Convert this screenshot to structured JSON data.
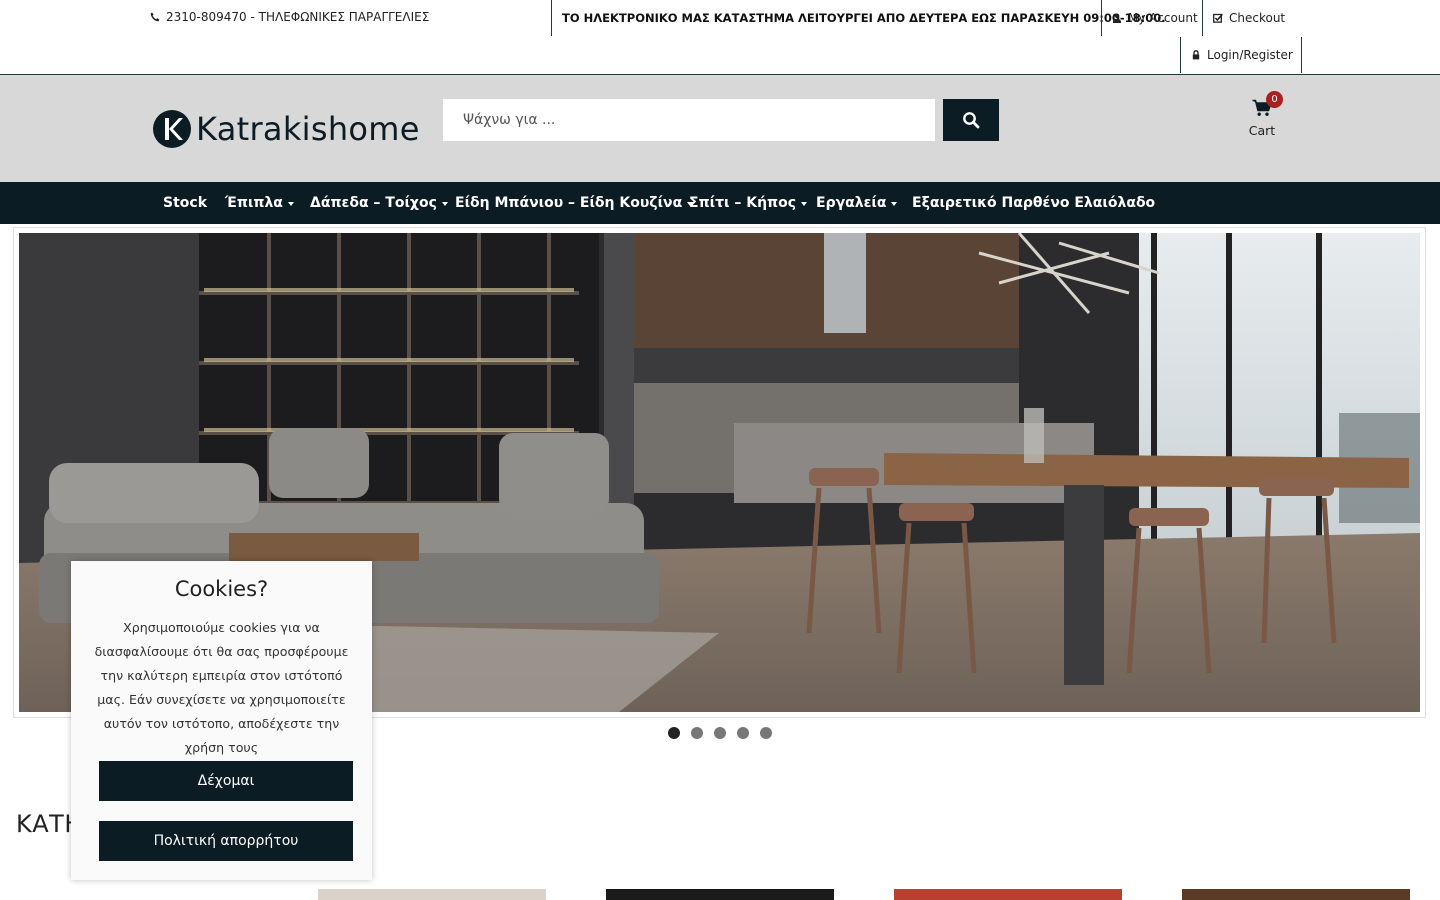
{
  "topbar": {
    "phone": "2310-809470 - ΤΗΛΕΦΩΝΙΚΕΣ ΠΑΡΑΓΓΕΛΙΕΣ",
    "notice": "ΤΟ ΗΛΕΚΤΡΟΝΙΚΟ ΜΑΣ ΚΑΤΑΣΤΗΜΑ ΛΕΙΤΟΥΡΓΕΙ ΑΠΟ ΔΕΥΤΕΡΑ ΕΩΣ ΠΑΡΑΣΚΕΥΗ 09:00-18:00.",
    "my_account": "My Account",
    "checkout": "Checkout",
    "login": "Login/Register"
  },
  "header": {
    "logo_text": "Katrakishome",
    "search_placeholder": "Ψάχνω για ...",
    "cart_label": "Cart",
    "cart_count": "0"
  },
  "nav": {
    "items": [
      {
        "label": "Stock"
      },
      {
        "label": "Έπιπλα"
      },
      {
        "label": "Δάπεδα – Τοίχος"
      },
      {
        "label": "Είδη Μπάνιου – Είδη Κουζίνα"
      },
      {
        "label": "Σπίτι – Κήπος"
      },
      {
        "label": "Εργαλεία"
      },
      {
        "label": "Εξαιρετικό Παρθένο Ελαιόλαδο"
      }
    ]
  },
  "slider": {
    "slide_count": 5,
    "active_index": 0
  },
  "categories": {
    "heading": "ΚΑΤΗΓΟΡΙΕΣ"
  },
  "cookie": {
    "title": "Cookies?",
    "text": "Χρησιμοποιούμε cookies για να διασφαλίσουμε ότι θα σας προσφέρουμε την καλύτερη εμπειρία στον ιστότοπό μας. Εάν συνεχίσετε να χρησιμοποιείτε αυτόν τον ιστότοπο, αποδέχεστε την χρήση τους",
    "accept_label": "Δέχομαι",
    "privacy_label": "Πολιτική απορρήτου"
  },
  "colors": {
    "brand_dark": "#0c1c24",
    "header_bg": "#d8d8d8",
    "badge": "#a82020"
  },
  "icons": [
    "phone-icon",
    "user-icon",
    "checkout-icon",
    "lock-icon",
    "search-icon",
    "cart-icon"
  ]
}
